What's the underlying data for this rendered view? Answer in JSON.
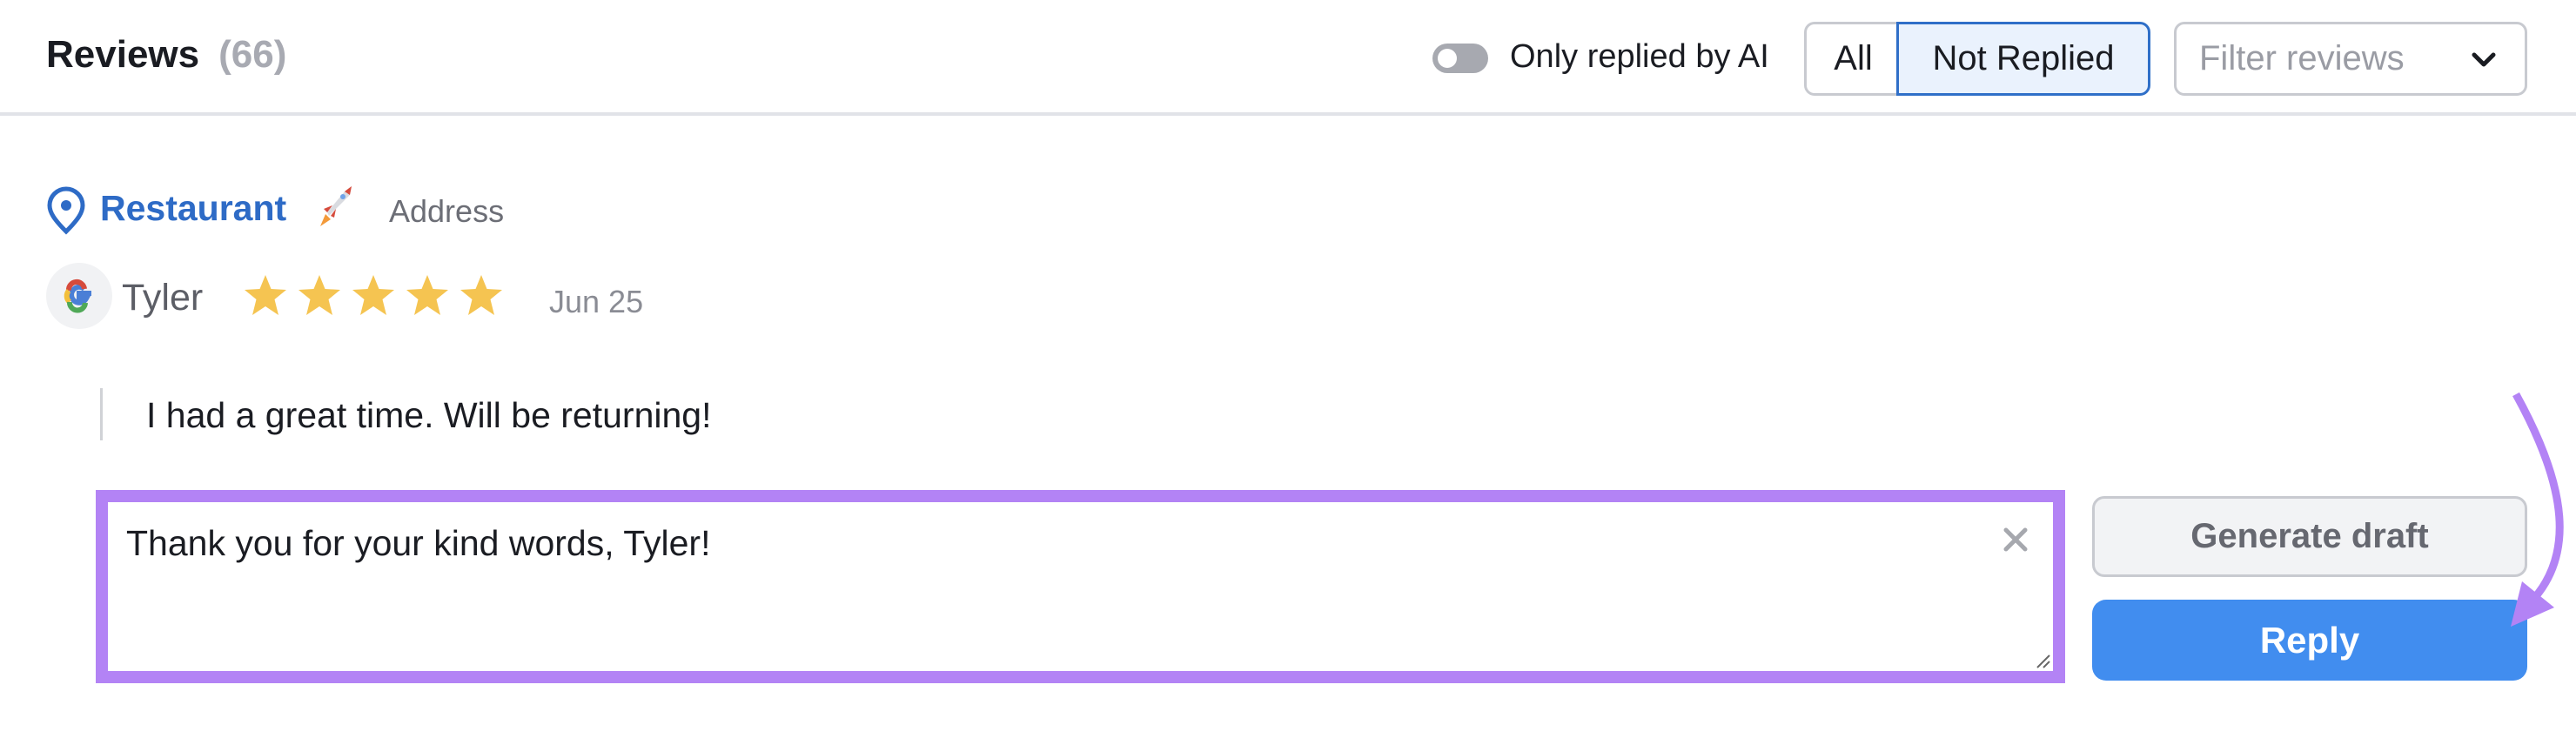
{
  "header": {
    "title": "Reviews",
    "count": "(66)",
    "toggle_label": "Only replied by AI",
    "toggle_on": false,
    "segments": [
      {
        "label": "All",
        "selected": false
      },
      {
        "label": "Not Replied",
        "selected": true
      }
    ],
    "filter_placeholder": "Filter reviews"
  },
  "review": {
    "location": "Restaurant",
    "location_emoji": "rocket",
    "address": "Address",
    "source": "google-icon",
    "author": "Tyler",
    "rating": 5,
    "rating_max": 5,
    "date": "Jun 25",
    "text": "I had a great time. Will be returning!"
  },
  "reply": {
    "value": "Thank you for your kind words, Tyler!",
    "generate_label": "Generate draft",
    "reply_label": "Reply"
  },
  "colors": {
    "accent": "#418def",
    "link": "#2e6bc6",
    "highlight": "#b383f5",
    "star": "#f5c451"
  }
}
